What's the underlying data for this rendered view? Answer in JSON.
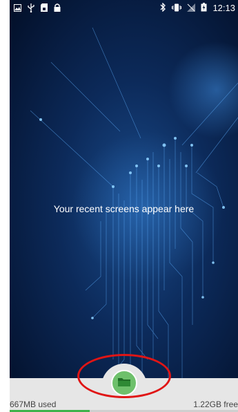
{
  "status_bar": {
    "left_icons": [
      "image-icon",
      "usb-icon",
      "sim-card-icon",
      "lock-icon"
    ],
    "right_icons": [
      "bluetooth-icon",
      "vibrate-icon",
      "no-signal-icon",
      "battery-charging-icon"
    ],
    "time": "12:13"
  },
  "recents": {
    "empty_message": "Your recent screens appear here"
  },
  "storage": {
    "used": "667MB used",
    "free": "1.22GB free",
    "used_fraction": 0.35
  },
  "files_button": {
    "icon": "folder-icon",
    "color": "#6ec06b"
  },
  "annotation": {
    "color": "#e01515"
  }
}
